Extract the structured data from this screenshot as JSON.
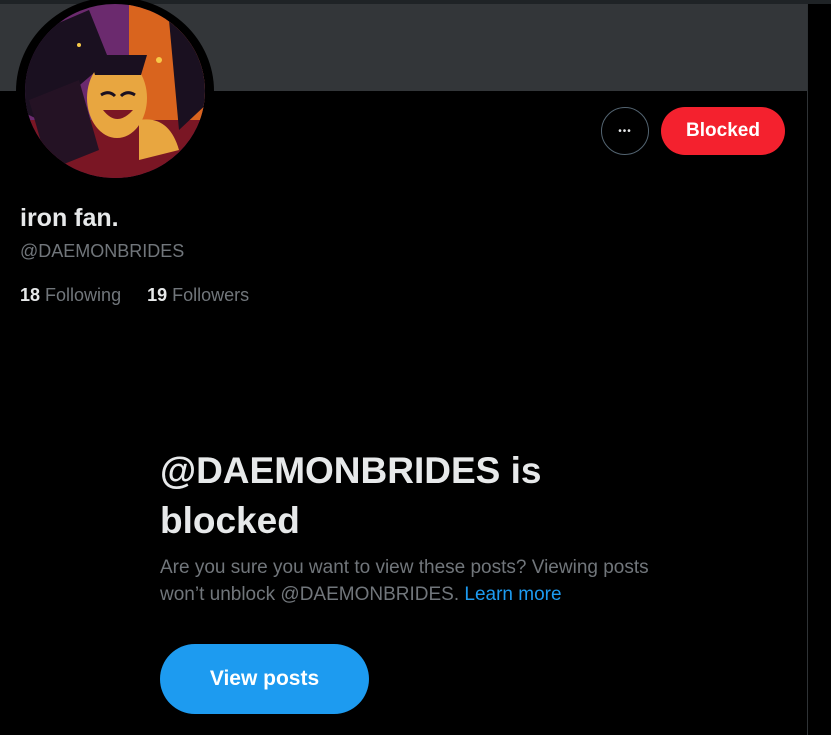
{
  "profile": {
    "display_name": "iron fan.",
    "handle": "@DAEMONBRIDES",
    "following_count": "18",
    "following_label": "Following",
    "followers_count": "19",
    "followers_label": "Followers",
    "avatar_icon": "cartoon-character-avatar"
  },
  "actions": {
    "more_icon": "more-horizontal-icon",
    "more_glyph": "•••",
    "blocked_label": "Blocked"
  },
  "blocked_notice": {
    "title": "@DAEMONBRIDES is blocked",
    "description": "Are you sure you want to view these posts? Viewing posts won’t unblock @DAEMONBRIDES.",
    "learn_more": "Learn more",
    "view_posts_label": "View posts"
  },
  "colors": {
    "background": "#000000",
    "banner": "#333639",
    "blocked_button": "#f4212e",
    "accent_blue": "#1d9bf0",
    "text_primary": "#e7e9ea",
    "text_secondary": "#71767b"
  }
}
